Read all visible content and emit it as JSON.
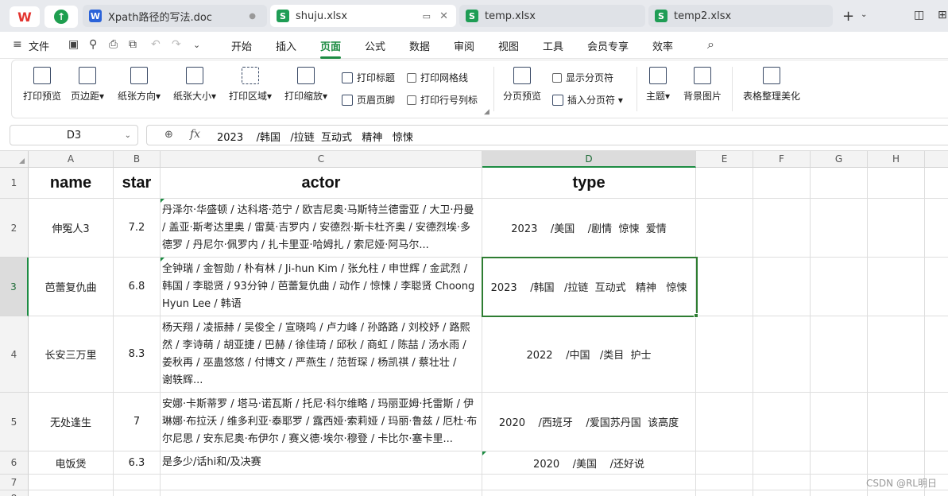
{
  "tabs": {
    "logo_label": "W",
    "home_glyph": "↑",
    "items": [
      {
        "label": "Xpath路径的写法.doc",
        "icon": "W"
      },
      {
        "label": "shuju.xlsx",
        "icon": "S"
      },
      {
        "label": "temp.xlsx",
        "icon": "S"
      },
      {
        "label": "temp2.xlsx",
        "icon": "S"
      }
    ],
    "close_glyph": "✕",
    "dot_glyph": "●",
    "plus_glyph": "+",
    "dropdown_glyph": "⌄"
  },
  "menu": {
    "hamburger": "≡",
    "file": "文件",
    "items": [
      "开始",
      "插入",
      "页面",
      "公式",
      "数据",
      "审阅",
      "视图",
      "工具",
      "会员专享",
      "效率"
    ],
    "active": "页面",
    "search_glyph": "⌕"
  },
  "ribbon": {
    "buttons": [
      {
        "label": "打印预览"
      },
      {
        "label": "页边距▾"
      },
      {
        "label": "纸张方向▾"
      },
      {
        "label": "纸张大小▾"
      },
      {
        "label": "打印区域▾"
      },
      {
        "label": "打印缩放▾"
      },
      {
        "label": "分页预览"
      },
      {
        "label": "主题▾"
      },
      {
        "label": "背景图片"
      },
      {
        "label": "表格整理美化"
      }
    ],
    "small": {
      "print_title": "打印标题",
      "header_footer": "页眉页脚",
      "print_gridlines": "打印网格线",
      "print_rowcol": "打印行号列标",
      "show_pagebreak": "显示分页符",
      "insert_pagebreak": "插入分页符 ▾"
    }
  },
  "formula_bar": {
    "name_box": "D3",
    "zoom_glyph": "⊕",
    "fx_label": "fx",
    "content": "2023    /韩国   /拉链  互动式   精神   惊悚"
  },
  "sheet": {
    "columns": [
      "A",
      "B",
      "C",
      "D",
      "E",
      "F",
      "G",
      "H"
    ],
    "selected_column": "D",
    "rows": [
      "1",
      "2",
      "3",
      "4",
      "5",
      "6",
      "7",
      "8"
    ],
    "selected_row": "3",
    "header": {
      "name": "name",
      "star": "star",
      "actor": "actor",
      "type": "type"
    },
    "data": [
      {
        "name": "伸冤人3",
        "star": "7.2",
        "actor": [
          "丹泽尔·华盛顿 / 达科塔·范宁 / 欧吉尼奥·马斯特兰德雷亚 / 大卫·丹曼",
          "/ 盖亚·斯考达里奥 / 雷莫·吉罗内 / 安德烈·斯卡杜齐奥 / 安德烈埃·多",
          "德罗 / 丹尼尔·佩罗内 / 扎卡里亚·哈姆扎 / 索尼娅·阿马尔..."
        ],
        "type": "2023    /美国    /剧情  惊悚  爱情"
      },
      {
        "name": "芭蕾复仇曲",
        "star": "6.8",
        "actor": [
          "全钟瑞 / 金智勋 / 朴有林 / Ji-hun Kim / 张允柱 / 申世辉 / 金武烈 /",
          "韩国 / 李聪贤 / 93分钟 / 芭蕾复仇曲 / 动作 / 惊悚 / 李聪贤 Choong",
          "Hyun Lee / 韩语"
        ],
        "type": "2023    /韩国   /拉链  互动式   精神   惊悚"
      },
      {
        "name": "长安三万里",
        "star": "8.3",
        "actor": [
          "杨天翔 / 凌振赫 / 吴俊全 / 宣晓鸣 / 卢力峰 / 孙路路 / 刘校妤 / 路熙",
          "然 / 李诗萌 / 胡亚捷 / 巴赫 / 徐佳琦 / 邱秋 / 商虹 / 陈喆 / 汤水雨 /",
          "姜秋再 / 巫蛊悠悠 / 付博文 / 严燕生 / 范哲琛 / 杨凯祺  / 蔡壮壮 /",
          "谢轶辉..."
        ],
        "type": "2022    /中国   /类目  护士"
      },
      {
        "name": "无处逢生",
        "star": "7",
        "actor": [
          "安娜·卡斯蒂罗 / 塔马·诺瓦斯 / 托尼·科尔维略 / 玛丽亚姆·托雷斯 / 伊",
          "琳娜·布拉沃 / 维多利亚·泰耶罗 / 露西娅·索莉娅 / 玛丽·鲁兹 / 厄杜·布",
          "尔尼思 / 安东尼奥·布伊尔 / 赛义德·埃尔·穆登 / 卡比尔·塞卡里..."
        ],
        "type": "2020    /西班牙    /爱国苏丹国  该高度"
      },
      {
        "name": "电饭煲",
        "star": "6.3",
        "actor": [
          "是多少/话hi和/及决赛"
        ],
        "type": "2020    /美国    /还好说"
      }
    ]
  },
  "watermark": "CSDN @RL明日"
}
